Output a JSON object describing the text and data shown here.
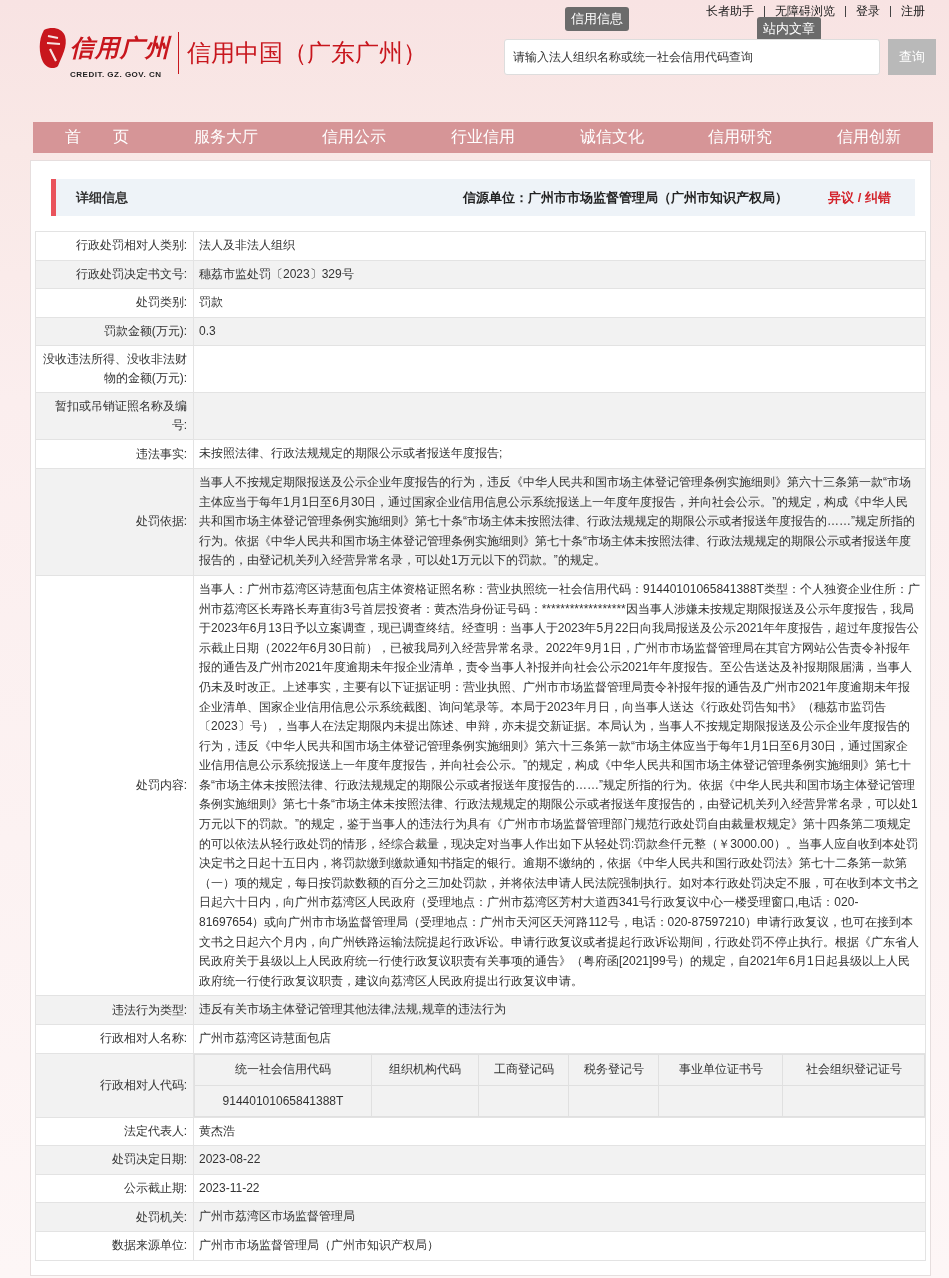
{
  "top_links": [
    {
      "label": "长者助手"
    },
    {
      "label": "无障碍浏览"
    },
    {
      "label": "登录"
    },
    {
      "label": "注册"
    }
  ],
  "tooltips": [
    {
      "label": "信用信息"
    },
    {
      "label": "站内文章"
    }
  ],
  "logo": {
    "text": "信用广州",
    "domain": "CREDIT. GZ. GOV. CN"
  },
  "site_title": "信用中国（广东广州）",
  "search": {
    "placeholder": "请输入法人组织名称或统一社会信用代码查询",
    "button": "查询"
  },
  "nav": [
    {
      "label": "首　　页"
    },
    {
      "label": "服务大厅"
    },
    {
      "label": "信用公示"
    },
    {
      "label": "行业信用"
    },
    {
      "label": "诚信文化"
    },
    {
      "label": "信用研究"
    },
    {
      "label": "信用创新"
    }
  ],
  "detail": {
    "title": "详细信息",
    "source": "信源单位：广州市市场监督管理局（广州市知识产权局）",
    "action": "异议 / 纠错"
  },
  "rows": [
    {
      "kind": "text",
      "label": "行政处罚相对人类别:",
      "value": "法人及非法人组织"
    },
    {
      "kind": "text",
      "label": "行政处罚决定书文号:",
      "value": "穗荔市监处罚〔2023〕329号"
    },
    {
      "kind": "text",
      "label": "处罚类别:",
      "value": "罚款"
    },
    {
      "kind": "text",
      "label": "罚款金额(万元):",
      "value": "0.3"
    },
    {
      "kind": "text",
      "label": "没收违法所得、没收非法财物的金额(万元):"
    },
    {
      "kind": "text",
      "label": "暂扣或吊销证照名称及编号:"
    },
    {
      "kind": "text",
      "label": "违法事实:",
      "value": "未按照法律、行政法规规定的期限公示或者报送年度报告;"
    },
    {
      "kind": "text",
      "label": "处罚依据:",
      "value": "当事人不按规定期限报送及公示企业年度报告的行为，违反《中华人民共和国市场主体登记管理条例实施细则》第六十三条第一款“市场主体应当于每年1月1日至6月30日，通过国家企业信用信息公示系统报送上一年度年度报告，并向社会公示。”的规定，构成《中华人民共和国市场主体登记管理条例实施细则》第七十条“市场主体未按照法律、行政法规规定的期限公示或者报送年度报告的……”规定所指的行为。依据《中华人民共和国市场主体登记管理条例实施细则》第七十条“市场主体未按照法律、行政法规规定的期限公示或者报送年度报告的，由登记机关列入经营异常名录，可以处1万元以下的罚款。”的规定。"
    },
    {
      "kind": "text",
      "label": "处罚内容:",
      "value": "当事人：广州市荔湾区诗慧面包店主体资格证照名称：营业执照统一社会信用代码：91440101065841388T类型：个人独资企业住所：广州市荔湾区长寿路长寿直街3号首层投资者：黄杰浩身份证号码：******************因当事人涉嫌未按规定期限报送及公示年度报告，我局于2023年6月13日予以立案调查，现已调查终结。经查明：当事人于2023年5月22日向我局报送及公示2021年年度报告，超过年度报告公示截止日期（2022年6月30日前），已被我局列入经营异常名录。2022年9月1日，广州市市场监督管理局在其官方网站公告责令补报年报的通告及广州市2021年度逾期未年报企业清单，责令当事人补报并向社会公示2021年年度报告。至公告送达及补报期限届满，当事人仍未及时改正。上述事实，主要有以下证据证明：营业执照、广州市市场监督管理局责令补报年报的通告及广州市2021年度逾期未年报企业清单、国家企业信用信息公示系统截图、询问笔录等。本局于2023年月日，向当事人送达《行政处罚告知书》（穗荔市监罚告〔2023〕号），当事人在法定期限内未提出陈述、申辩，亦未提交新证据。本局认为，当事人不按规定期限报送及公示企业年度报告的行为，违反《中华人民共和国市场主体登记管理条例实施细则》第六十三条第一款“市场主体应当于每年1月1日至6月30日，通过国家企业信用信息公示系统报送上一年度年度报告，并向社会公示。”的规定，构成《中华人民共和国市场主体登记管理条例实施细则》第七十条“市场主体未按照法律、行政法规规定的期限公示或者报送年度报告的……”规定所指的行为。依据《中华人民共和国市场主体登记管理条例实施细则》第七十条“市场主体未按照法律、行政法规规定的期限公示或者报送年度报告的，由登记机关列入经营异常名录，可以处1万元以下的罚款。”的规定，鉴于当事人的违法行为具有《广州市市场监督管理部门规范行政处罚自由裁量权规定》第十四条第二项规定的可以依法从轻行政处罚的情形，经综合裁量，现决定对当事人作出如下从轻处罚:罚款叁仟元整（￥3000.00）。当事人应自收到本处罚决定书之日起十五日内，将罚款缴到缴款通知书指定的银行。逾期不缴纳的，依据《中华人民共和国行政处罚法》第七十二条第一款第（一）项的规定，每日按罚款数额的百分之三加处罚款，并将依法申请人民法院强制执行。如对本行政处罚决定不服，可在收到本文书之日起六十日内，向广州市荔湾区人民政府（受理地点：广州市荔湾区芳村大道西341号行政复议中心一楼受理窗口,电话：020-81697654）或向广州市市场监督管理局（受理地点：广州市天河区天河路112号，电话：020-87597210）申请行政复议，也可在接到本文书之日起六个月内，向广州铁路运输法院提起行政诉讼。申请行政复议或者提起行政诉讼期间，行政处罚不停止执行。根据《广东省人民政府关于县级以上人民政府统一行使行政复议职责有关事项的通告》（粤府函[2021]99号）的规定，自2021年6月1日起县级以上人民政府统一行使行政复议职责，建议向荔湾区人民政府提出行政复议申请。"
    },
    {
      "kind": "text",
      "label": "违法行为类型:",
      "value": "违反有关市场主体登记管理其他法律,法规,规章的违法行为"
    },
    {
      "kind": "text",
      "label": "行政相对人名称:",
      "value": "广州市荔湾区诗慧面包店"
    },
    {
      "kind": "codes",
      "label": "行政相对人代码:",
      "columns": [
        "统一社会信用代码",
        "组织机构代码",
        "工商登记码",
        "税务登记号",
        "事业单位证书号",
        "社会组织登记证号"
      ],
      "values": [
        "91440101065841388T"
      ]
    },
    {
      "kind": "text",
      "label": "法定代表人:",
      "value": "黄杰浩"
    },
    {
      "kind": "text",
      "label": "处罚决定日期:",
      "value": "2023-08-22"
    },
    {
      "kind": "text",
      "label": "公示截止期:",
      "value": "2023-11-22"
    },
    {
      "kind": "text",
      "label": "处罚机关:",
      "value": "广州市荔湾区市场监督管理局"
    },
    {
      "kind": "text",
      "label": "数据来源单位:",
      "value": "广州市市场监督管理局（广州市知识产权局）"
    }
  ]
}
